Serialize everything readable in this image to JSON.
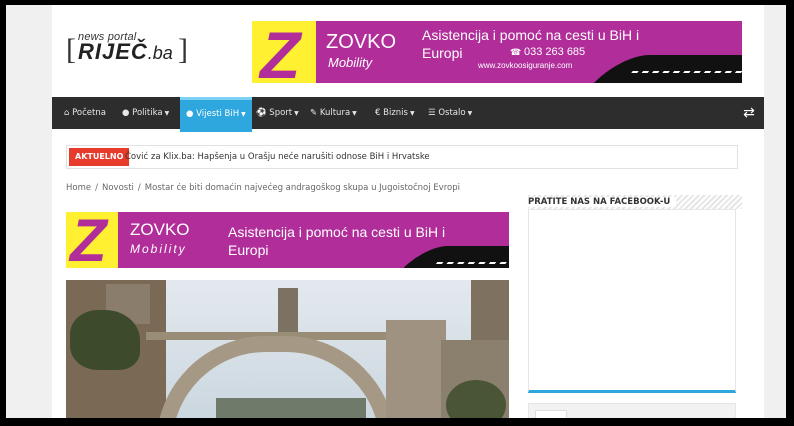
{
  "header": {
    "logo_top": "news portal",
    "logo_main": "RIJEČ",
    "logo_tld": ".ba"
  },
  "ad_top": {
    "brand": "ZOVKO",
    "brand_sub": "Mobility",
    "headline_line1": "Asistencija i pomoć na cesti u BiH i",
    "headline_line2": "Europi",
    "phone": "033 263 685",
    "url": "www.zovkoosiguranje.com",
    "colors": {
      "background": "#b02d9a",
      "accent": "#fff031"
    }
  },
  "nav": {
    "items": [
      {
        "label": "Početna",
        "icon": "home-icon"
      },
      {
        "label": "Politika",
        "icon": "globe-icon",
        "dropdown": true
      },
      {
        "label": "Vijesti BiH",
        "icon": "globe-icon",
        "dropdown": true,
        "active": true
      },
      {
        "label": "Sport",
        "icon": "ball-icon",
        "dropdown": true
      },
      {
        "label": "Kultura",
        "icon": "theatre-icon",
        "dropdown": true
      },
      {
        "label": "Biznis",
        "icon": "euro-icon",
        "dropdown": true
      },
      {
        "label": "Ostalo",
        "icon": "list-icon",
        "dropdown": true
      }
    ],
    "shuffle_icon": "shuffle-icon",
    "colors": {
      "bar": "#2d2d2d",
      "active": "#2ea6de"
    }
  },
  "breaking": {
    "tag": "AKTUELNO",
    "text": "Čović za Klix.ba: Hapšenja u Orašju neće narušiti odnose BiH i Hrvatske"
  },
  "breadcrumb": {
    "home": "Home",
    "section": "Novosti",
    "current": "Mostar će biti domaćin najvećeg andragoškog skupa u Jugoistočnoj Evropi",
    "separator": "/"
  },
  "ad_mid": {
    "brand": "ZOVKO",
    "brand_sub": "Mobility",
    "headline_line1": "Asistencija i pomoć na cesti u BiH i",
    "headline_line2": "Europi"
  },
  "sidebar": {
    "facebook_title": "PRATITE NAS NA FACEBOOK-U"
  }
}
